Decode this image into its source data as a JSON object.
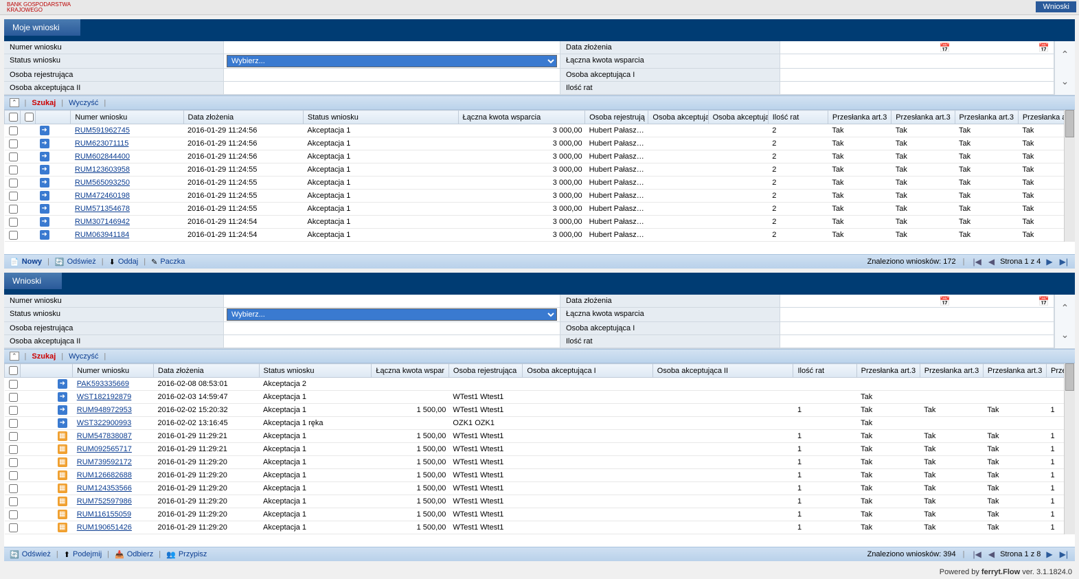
{
  "topButton": "Wnioski",
  "logo1": "BANK GOSPODARSTWA",
  "logo2": "KRAJOWEGO",
  "panel1": {
    "tab": "Moje wnioski",
    "filters": {
      "numer_wniosku": "Numer wniosku",
      "data_zlozenia": "Data złożenia",
      "status_wniosku": "Status wniosku",
      "status_ph": "Wybierz...",
      "laczna_kwota": "Łączna kwota wsparcia",
      "osoba_rej": "Osoba rejestrująca",
      "osoba_akc1": "Osoba akceptująca I",
      "osoba_akc2": "Osoba akceptująca II",
      "ilosc_rat": "Ilość rat"
    },
    "actions": {
      "szukaj": "Szukaj",
      "wyczysc": "Wyczyść"
    },
    "headers": [
      "",
      "",
      "",
      "Numer wniosku",
      "Data złożenia",
      "Status wniosku",
      "Łączna kwota wsparcia",
      "Osoba rejestrują",
      "Osoba akceptują",
      "Osoba akceptują",
      "Ilość rat",
      "Przesłanka art.3",
      "Przesłanka art.3",
      "Przesłanka art.3",
      "Przesłanka a"
    ],
    "rows": [
      {
        "n": "RUM591962745",
        "d": "2016-01-29 11:24:56",
        "s": "Akceptacja 1",
        "k": "3 000,00",
        "o": "Hubert Pałasze...",
        "r": "2",
        "p": "Tak"
      },
      {
        "n": "RUM623071115",
        "d": "2016-01-29 11:24:56",
        "s": "Akceptacja 1",
        "k": "3 000,00",
        "o": "Hubert Pałasze...",
        "r": "2",
        "p": "Tak"
      },
      {
        "n": "RUM602844400",
        "d": "2016-01-29 11:24:56",
        "s": "Akceptacja 1",
        "k": "3 000,00",
        "o": "Hubert Pałasze...",
        "r": "2",
        "p": "Tak"
      },
      {
        "n": "RUM123603958",
        "d": "2016-01-29 11:24:55",
        "s": "Akceptacja 1",
        "k": "3 000,00",
        "o": "Hubert Pałasze...",
        "r": "2",
        "p": "Tak"
      },
      {
        "n": "RUM565093250",
        "d": "2016-01-29 11:24:55",
        "s": "Akceptacja 1",
        "k": "3 000,00",
        "o": "Hubert Pałasze...",
        "r": "2",
        "p": "Tak"
      },
      {
        "n": "RUM472460198",
        "d": "2016-01-29 11:24:55",
        "s": "Akceptacja 1",
        "k": "3 000,00",
        "o": "Hubert Pałasze...",
        "r": "2",
        "p": "Tak"
      },
      {
        "n": "RUM571354678",
        "d": "2016-01-29 11:24:55",
        "s": "Akceptacja 1",
        "k": "3 000,00",
        "o": "Hubert Pałasze...",
        "r": "2",
        "p": "Tak"
      },
      {
        "n": "RUM307146942",
        "d": "2016-01-29 11:24:54",
        "s": "Akceptacja 1",
        "k": "3 000,00",
        "o": "Hubert Pałasze...",
        "r": "2",
        "p": "Tak"
      },
      {
        "n": "RUM063941184",
        "d": "2016-01-29 11:24:54",
        "s": "Akceptacja 1",
        "k": "3 000,00",
        "o": "Hubert Pałasze...",
        "r": "2",
        "p": "Tak"
      }
    ],
    "status": {
      "nowy": "Nowy",
      "odswiez": "Odśwież",
      "oddaj": "Oddaj",
      "paczka": "Paczka",
      "found": "Znaleziono wniosków: 172",
      "page": "Strona 1 z 4"
    }
  },
  "panel2": {
    "tab": "Wnioski",
    "filters": {
      "numer_wniosku": "Numer wniosku",
      "data_zlozenia": "Data złożenia",
      "status_wniosku": "Status wniosku",
      "status_ph": "Wybierz...",
      "laczna_kwota": "Łączna kwota wsparcia",
      "osoba_rej": "Osoba rejestrująca",
      "osoba_akc1": "Osoba akceptująca I",
      "osoba_akc2": "Osoba akceptująca II",
      "ilosc_rat": "Ilość rat"
    },
    "actions": {
      "szukaj": "Szukaj",
      "wyczysc": "Wyczyść"
    },
    "headers": [
      "",
      "",
      "Numer wniosku",
      "Data złożenia",
      "Status wniosku",
      "Łączna kwota wspar",
      "Osoba rejestrująca",
      "Osoba akceptująca I",
      "Osoba akceptująca II",
      "Ilość rat",
      "Przesłanka art.3",
      "Przesłanka art.3",
      "Przesłanka art.3",
      "Prze"
    ],
    "rows": [
      {
        "ic": "b",
        "n": "PAK593335669",
        "d": "2016-02-08 08:53:01",
        "s": "Akceptacja 2",
        "k": "",
        "o": "",
        "r": "",
        "p1": "",
        "p2": "",
        "p3": ""
      },
      {
        "ic": "b",
        "n": "WST182192879",
        "d": "2016-02-03 14:59:47",
        "s": "Akceptacja 1",
        "k": "",
        "o": "WTest1 Wtest1",
        "r": "",
        "p1": "Tak",
        "p2": "",
        "p3": ""
      },
      {
        "ic": "b",
        "n": "RUM948972953",
        "d": "2016-02-02 15:20:32",
        "s": "Akceptacja 1",
        "k": "1 500,00",
        "o": "WTest1 Wtest1",
        "r": "1",
        "p1": "Tak",
        "p2": "Tak",
        "p3": "Tak"
      },
      {
        "ic": "b",
        "n": "WST322900993",
        "d": "2016-02-02 13:16:45",
        "s": "Akceptacja 1 ręka",
        "k": "",
        "o": "OZK1 OZK1",
        "r": "",
        "p1": "Tak",
        "p2": "",
        "p3": ""
      },
      {
        "ic": "o",
        "n": "RUM547838087",
        "d": "2016-01-29 11:29:21",
        "s": "Akceptacja 1",
        "k": "1 500,00",
        "o": "WTest1 Wtest1",
        "r": "1",
        "p1": "Tak",
        "p2": "Tak",
        "p3": "Tak"
      },
      {
        "ic": "o",
        "n": "RUM092565717",
        "d": "2016-01-29 11:29:21",
        "s": "Akceptacja 1",
        "k": "1 500,00",
        "o": "WTest1 Wtest1",
        "r": "1",
        "p1": "Tak",
        "p2": "Tak",
        "p3": "Tak"
      },
      {
        "ic": "o",
        "n": "RUM739592172",
        "d": "2016-01-29 11:29:20",
        "s": "Akceptacja 1",
        "k": "1 500,00",
        "o": "WTest1 Wtest1",
        "r": "1",
        "p1": "Tak",
        "p2": "Tak",
        "p3": "Tak"
      },
      {
        "ic": "o",
        "n": "RUM126682688",
        "d": "2016-01-29 11:29:20",
        "s": "Akceptacja 1",
        "k": "1 500,00",
        "o": "WTest1 Wtest1",
        "r": "1",
        "p1": "Tak",
        "p2": "Tak",
        "p3": "Tak"
      },
      {
        "ic": "o",
        "n": "RUM124353566",
        "d": "2016-01-29 11:29:20",
        "s": "Akceptacja 1",
        "k": "1 500,00",
        "o": "WTest1 Wtest1",
        "r": "1",
        "p1": "Tak",
        "p2": "Tak",
        "p3": "Tak"
      },
      {
        "ic": "o",
        "n": "RUM752597986",
        "d": "2016-01-29 11:29:20",
        "s": "Akceptacja 1",
        "k": "1 500,00",
        "o": "WTest1 Wtest1",
        "r": "1",
        "p1": "Tak",
        "p2": "Tak",
        "p3": "Tak"
      },
      {
        "ic": "o",
        "n": "RUM116155059",
        "d": "2016-01-29 11:29:20",
        "s": "Akceptacja 1",
        "k": "1 500,00",
        "o": "WTest1 Wtest1",
        "r": "1",
        "p1": "Tak",
        "p2": "Tak",
        "p3": "Tak"
      },
      {
        "ic": "o",
        "n": "RUM190651426",
        "d": "2016-01-29 11:29:20",
        "s": "Akceptacja 1",
        "k": "1 500,00",
        "o": "WTest1 Wtest1",
        "r": "1",
        "p1": "Tak",
        "p2": "Tak",
        "p3": "Tak"
      }
    ],
    "status": {
      "odswiez": "Odśwież",
      "podejmij": "Podejmij",
      "odbierz": "Odbierz",
      "przypisz": "Przypisz",
      "found": "Znaleziono wniosków: 394",
      "page": "Strona 1 z 8"
    }
  },
  "footer": {
    "prefix": "Powered by ",
    "product": "ferryt.Flow",
    "ver": " ver. 3.1.1824.0"
  }
}
